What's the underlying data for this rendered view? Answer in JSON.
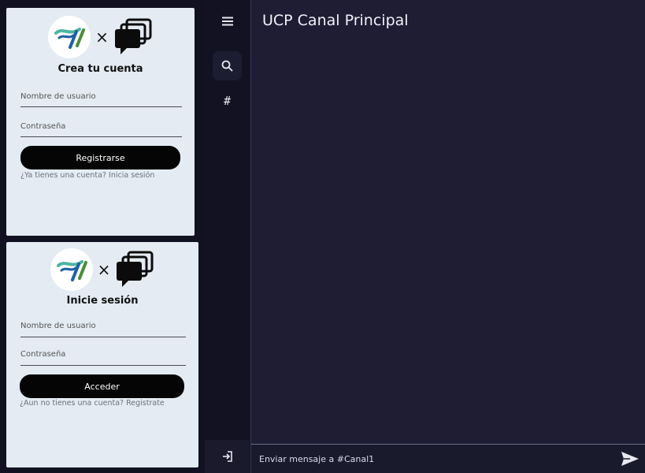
{
  "register_card": {
    "title": "Crea tu cuenta",
    "username_placeholder": "Nombre de usuario",
    "password_placeholder": "Contraseña",
    "submit_label": "Registrarse",
    "hint": "¿Ya tienes una cuenta? Inicia sesión",
    "times_symbol": "×"
  },
  "login_card": {
    "title": "Inicie sesión",
    "username_placeholder": "Nombre de usuario",
    "password_placeholder": "Contraseña",
    "submit_label": "Acceder",
    "hint": "¿Aun no tienes una cuenta? Registrate",
    "times_symbol": "×"
  },
  "rail": {
    "items": [
      {
        "icon": "hamburger-menu-icon"
      },
      {
        "icon": "search-icon"
      },
      {
        "icon": "hash-channel-icon",
        "glyph": "#"
      }
    ],
    "bottom_icon": "logout-icon"
  },
  "channel": {
    "title": "UCP Canal Principal",
    "composer_placeholder": "Enviar mensaje a #Canal1",
    "send_icon": "send-icon"
  },
  "colors": {
    "card_bg": "#e4ebf2",
    "button_bg": "#050505",
    "main_bg": "#1e1d33",
    "rail_bg": "#121223"
  }
}
